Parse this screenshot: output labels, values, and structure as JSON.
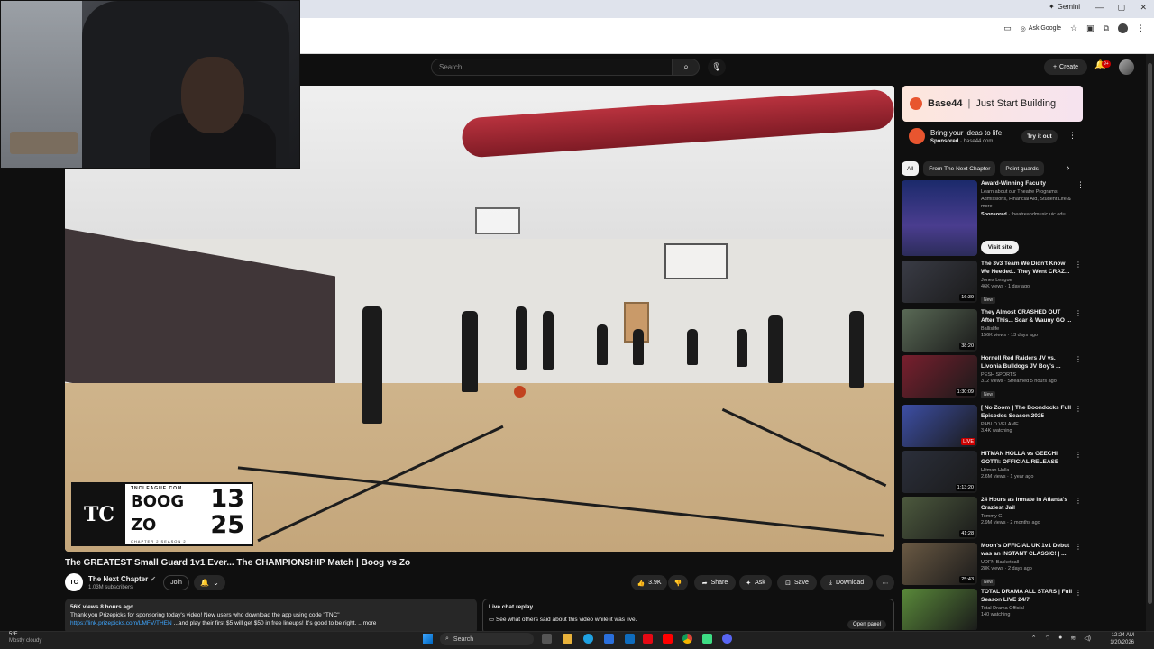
{
  "browser": {
    "gemini_label": "Gemini",
    "ask_google_label": "Ask Google"
  },
  "youtube": {
    "search_placeholder": "Search",
    "create_label": "Create",
    "notif_count": "9+"
  },
  "video": {
    "title": "The GREATEST Small Guard 1v1 Ever... The CHAMPIONSHIP Match | Boog vs Zo",
    "scorebug": {
      "league": "TNCLEAGUE.COM",
      "player1": "BOOG",
      "score1": "13",
      "player2": "ZO",
      "score2": "25",
      "chapter": "CHAPTER 2 SEASON 2"
    }
  },
  "channel": {
    "name": "The Next Chapter",
    "subs": "1.03M subscribers",
    "join_label": "Join"
  },
  "actions": {
    "likes": "3.9K",
    "share": "Share",
    "ask": "Ask",
    "save": "Save",
    "download": "Download"
  },
  "description": {
    "stats": "56K views  8 hours ago",
    "line1": "Thank you Prizepicks for sponsoring today's video! New users who download the app using code \"TNC\"",
    "link": "https://link.prizepicks.com/LMFV/THEN",
    "line2": "...and play their first $5 will get $50 in free lineups! It's good to be right.",
    "more": "...more"
  },
  "livechat": {
    "title": "Live chat replay",
    "text": "See what others said about this video while it was live.",
    "open_panel": "Open panel"
  },
  "ad": {
    "brand": "Base44",
    "tagline": "Just Start Building",
    "headline": "Bring your ideas to life",
    "sponsored": "Sponsored",
    "domain": "base44.com",
    "cta": "Try it out"
  },
  "chips": [
    "All",
    "From The Next Chapter",
    "Point guards"
  ],
  "sponsored_rec": {
    "title": "Award-Winning Faculty",
    "desc": "Learn about our Theatre Programs, Admissions, Financial Aid, Student Life & more",
    "sponsored": "Sponsored",
    "domain": "theatreandmusic.uic.edu",
    "cta": "Visit site"
  },
  "recs": [
    {
      "title": "The 3v3 Team We Didn't Know We Needed.. They Went CRAZ...",
      "channel": "Jones League",
      "meta": "46K views · 1 day ago",
      "badge": "New",
      "dur": "16:39",
      "thumb": "#3a3c46",
      "live": false
    },
    {
      "title": "They Almost CRASHED OUT After This... Scar & Wauny GO ...",
      "channel": "Ballislife",
      "meta": "156K views · 13 days ago",
      "badge": "",
      "dur": "38:20",
      "thumb": "#5a6a56",
      "live": false
    },
    {
      "title": "Hornell Red Raiders JV vs. Livonia Bulldogs JV Boy's ...",
      "channel": "PESH SPORTS",
      "meta": "312 views · Streamed 5 hours ago",
      "badge": "New",
      "dur": "1:30:09",
      "thumb": "#7a1f2e",
      "live": false
    },
    {
      "title": "[ No Zoom ] The Boondocks Full Episodes Season 2025",
      "channel": "PABLO VELAME",
      "meta": "3.4K watching",
      "badge": "",
      "dur": "LIVE",
      "thumb": "#3d4fa6",
      "live": true
    },
    {
      "title": "HITMAN HOLLA vs GEECHI GOTTI: OFFICIAL RELEASE",
      "channel": "Hitman Holla",
      "meta": "2.6M views · 1 year ago",
      "badge": "",
      "dur": "1:13:20",
      "thumb": "#2b2f3b",
      "live": false
    },
    {
      "title": "24 Hours as Inmate in Atlanta's Craziest Jail",
      "channel": "Tommy G",
      "meta": "2.9M views · 2 months ago",
      "badge": "",
      "dur": "41:28",
      "thumb": "#4d5a3e",
      "live": false
    },
    {
      "title": "Moon's OFFICIAL UK 1v1 Debut was an INSTANT CLASSIC! | ...",
      "channel": "UDFN Basketball",
      "meta": "28K views · 2 days ago",
      "badge": "New",
      "dur": "25:43",
      "thumb": "#6b5a44",
      "live": false
    },
    {
      "title": "TOTAL DRAMA ALL STARS | Full Season LIVE 24/7",
      "channel": "Total Drama Official",
      "meta": "140 watching",
      "badge": "",
      "dur": "",
      "thumb": "#5a8a3a",
      "live": false
    }
  ],
  "taskbar": {
    "temp": "5°F",
    "weather": "Mostly cloudy",
    "search": "Search",
    "time": "12:24 AM",
    "date": "1/20/2026"
  }
}
